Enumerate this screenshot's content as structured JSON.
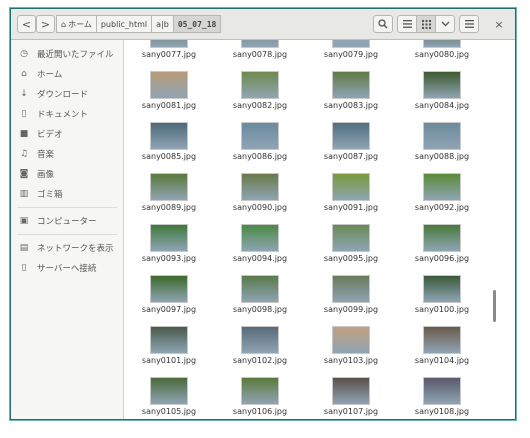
{
  "toolbar": {
    "back_label": "<",
    "forward_label": ">",
    "breadcrumbs": [
      {
        "label": "ホーム"
      },
      {
        "label": "public_html"
      },
      {
        "label": "a|b"
      },
      {
        "label": "05_07_18"
      }
    ],
    "search_icon": "search-icon",
    "list_view_icon": "list-view-icon",
    "grid_view_icon": "grid-view-icon",
    "menu_icon": "menu-icon",
    "close_label": "×"
  },
  "sidebar": {
    "items": [
      {
        "label": "最近開いたファイル",
        "icon": "clock-icon"
      },
      {
        "label": "ホーム",
        "icon": "home-icon"
      },
      {
        "label": "ダウンロード",
        "icon": "download-icon"
      },
      {
        "label": "ドキュメント",
        "icon": "document-icon"
      },
      {
        "label": "ビデオ",
        "icon": "video-icon"
      },
      {
        "label": "音楽",
        "icon": "music-icon"
      },
      {
        "label": "画像",
        "icon": "camera-icon"
      },
      {
        "label": "ゴミ箱",
        "icon": "trash-icon"
      },
      {
        "label": "コンピューター",
        "icon": "computer-icon"
      },
      {
        "label": "ネットワークを表示",
        "icon": "network-icon"
      },
      {
        "label": "サーバーへ接続",
        "icon": "server-icon"
      }
    ]
  },
  "files": [
    {
      "name": "sany0077.jpg",
      "color": "#5d6b5a"
    },
    {
      "name": "sany0078.jpg",
      "color": "#6d8070"
    },
    {
      "name": "sany0079.jpg",
      "color": "#9aa0a8"
    },
    {
      "name": "sany0080.jpg",
      "color": "#4a5a3a"
    },
    {
      "name": "sany0081.jpg",
      "color": "#b89a78"
    },
    {
      "name": "sany0082.jpg",
      "color": "#6f8a4e"
    },
    {
      "name": "sany0083.jpg",
      "color": "#5f7a45"
    },
    {
      "name": "sany0084.jpg",
      "color": "#3e5a2f"
    },
    {
      "name": "sany0085.jpg",
      "color": "#4d6a7a"
    },
    {
      "name": "sany0086.jpg",
      "color": "#6a8aa0"
    },
    {
      "name": "sany0087.jpg",
      "color": "#4f6f80"
    },
    {
      "name": "sany0088.jpg",
      "color": "#6c8a9a"
    },
    {
      "name": "sany0089.jpg",
      "color": "#5a7a3a"
    },
    {
      "name": "sany0090.jpg",
      "color": "#6a7a4a"
    },
    {
      "name": "sany0091.jpg",
      "color": "#7a9a3a"
    },
    {
      "name": "sany0092.jpg",
      "color": "#5a8a3a"
    },
    {
      "name": "sany0093.jpg",
      "color": "#3f7a3a"
    },
    {
      "name": "sany0094.jpg",
      "color": "#4a8a45"
    },
    {
      "name": "sany0095.jpg",
      "color": "#6a8a55"
    },
    {
      "name": "sany0096.jpg",
      "color": "#4a7a3a"
    },
    {
      "name": "sany0097.jpg",
      "color": "#3a6a2a"
    },
    {
      "name": "sany0098.jpg",
      "color": "#5a7a4a"
    },
    {
      "name": "sany0099.jpg",
      "color": "#6a7a5a"
    },
    {
      "name": "sany0100.jpg",
      "color": "#3a5a3a"
    },
    {
      "name": "sany0101.jpg",
      "color": "#4a5a4a"
    },
    {
      "name": "sany0102.jpg",
      "color": "#5a6a7a"
    },
    {
      "name": "sany0103.jpg",
      "color": "#c0a080"
    },
    {
      "name": "sany0104.jpg",
      "color": "#6a5a4a"
    },
    {
      "name": "sany0105.jpg",
      "color": "#4a6a3a"
    },
    {
      "name": "sany0106.jpg",
      "color": "#5a7a3a"
    },
    {
      "name": "sany0107.jpg",
      "color": "#5a5048"
    },
    {
      "name": "sany0108.jpg",
      "color": "#5a5a6a"
    }
  ]
}
